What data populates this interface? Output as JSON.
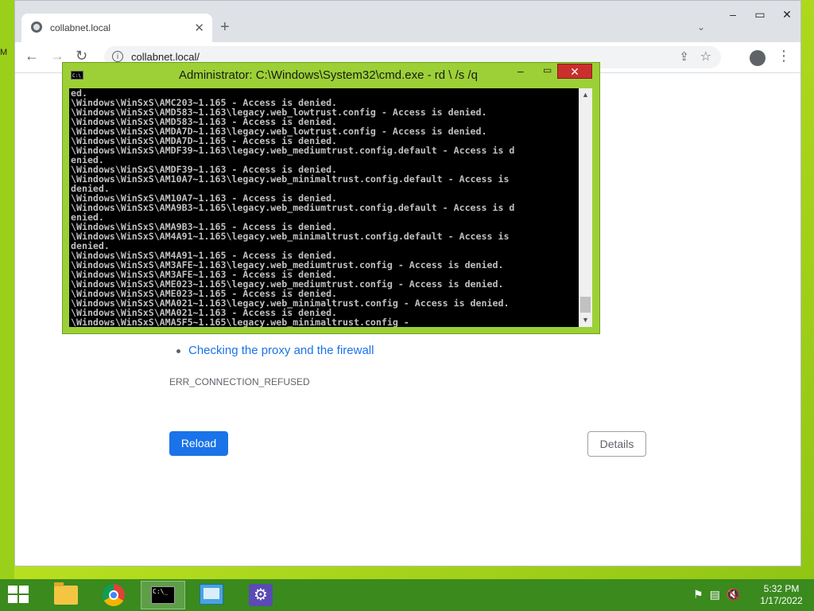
{
  "desktop": {
    "edge_label": "M"
  },
  "browser": {
    "tab_title": "collabnet.local",
    "new_tab_symbol": "+",
    "url": "collabnet.local/",
    "page": {
      "suggestion": "Checking the proxy and the firewall",
      "error_code": "ERR_CONNECTION_REFUSED",
      "reload_label": "Reload",
      "details_label": "Details"
    }
  },
  "cmd": {
    "title": "Administrator: C:\\Windows\\System32\\cmd.exe - rd  \\ /s /q",
    "lines": [
      "ed.",
      "\\Windows\\WinSxS\\AMC203~1.165 - Access is denied.",
      "\\Windows\\WinSxS\\AMD583~1.163\\legacy.web_lowtrust.config - Access is denied.",
      "\\Windows\\WinSxS\\AMD583~1.163 - Access is denied.",
      "\\Windows\\WinSxS\\AMDA7D~1.163\\legacy.web_lowtrust.config - Access is denied.",
      "\\Windows\\WinSxS\\AMDA7D~1.165 - Access is denied.",
      "\\Windows\\WinSxS\\AMDF39~1.163\\legacy.web_mediumtrust.config.default - Access is d",
      "enied.",
      "\\Windows\\WinSxS\\AMDF39~1.163 - Access is denied.",
      "\\Windows\\WinSxS\\AM10A7~1.163\\legacy.web_minimaltrust.config.default - Access is",
      "denied.",
      "\\Windows\\WinSxS\\AM10A7~1.163 - Access is denied.",
      "\\Windows\\WinSxS\\AMA9B3~1.165\\legacy.web_mediumtrust.config.default - Access is d",
      "enied.",
      "\\Windows\\WinSxS\\AMA9B3~1.165 - Access is denied.",
      "\\Windows\\WinSxS\\AM4A91~1.165\\legacy.web_minimaltrust.config.default - Access is",
      "denied.",
      "\\Windows\\WinSxS\\AM4A91~1.165 - Access is denied.",
      "\\Windows\\WinSxS\\AM3AFE~1.163\\legacy.web_mediumtrust.config - Access is denied.",
      "\\Windows\\WinSxS\\AM3AFE~1.163 - Access is denied.",
      "\\Windows\\WinSxS\\AME023~1.165\\legacy.web_mediumtrust.config - Access is denied.",
      "\\Windows\\WinSxS\\AME023~1.165 - Access is denied.",
      "\\Windows\\WinSxS\\AMA021~1.163\\legacy.web_minimaltrust.config - Access is denied.",
      "\\Windows\\WinSxS\\AMA021~1.163 - Access is denied.",
      "\\Windows\\WinSxS\\AMA5F5~1.165\\legacy.web_minimaltrust.config -"
    ]
  },
  "taskbar": {
    "clock_time": "5:32 PM",
    "clock_date": "1/17/2022"
  },
  "colors": {
    "desktop_bg": "#9bd11c",
    "taskbar_bg": "#3a8a1e",
    "link_blue": "#1a73e8",
    "cmd_frame": "#9cd036",
    "close_red": "#c9302c"
  },
  "icons": [
    "globe-icon",
    "close-icon",
    "plus-icon",
    "chevron-down-icon",
    "back-icon",
    "forward-icon",
    "reload-icon",
    "info-icon",
    "share-icon",
    "star-icon",
    "profile-icon",
    "kebab-menu-icon",
    "cmd-icon",
    "windows-start-icon",
    "folder-icon",
    "chrome-icon",
    "terminal-icon",
    "network-icon",
    "settings-gear-icon",
    "flag-icon",
    "network-tray-icon",
    "volume-muted-icon"
  ]
}
